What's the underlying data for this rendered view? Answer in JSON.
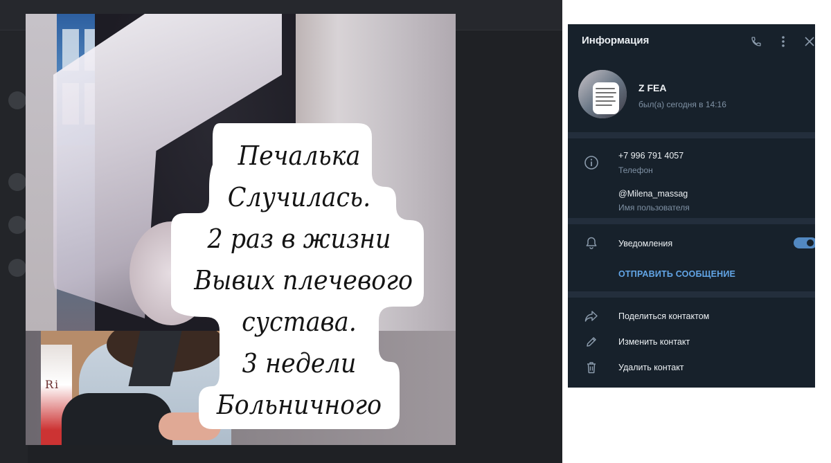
{
  "info_panel": {
    "title": "Информация",
    "header_icons": [
      "phone-icon",
      "more-vertical-icon",
      "close-icon"
    ],
    "contact": {
      "name": "Z FEA",
      "last_seen": "был(а) сегодня в 14:16"
    },
    "phone": {
      "value": "+7 996 791 4057",
      "label": "Телефон"
    },
    "username": {
      "value": "@Milena_massag",
      "label": "Имя пользователя"
    },
    "notifications": {
      "label": "Уведомления",
      "enabled": true
    },
    "send_message_label": "ОТПРАВИТЬ СООБЩЕНИЕ",
    "actions": [
      {
        "icon": "share-icon",
        "label": "Поделиться контактом"
      },
      {
        "icon": "pencil-icon",
        "label": "Изменить контакт"
      },
      {
        "icon": "trash-icon",
        "label": "Удалить контакт"
      }
    ],
    "colors": {
      "panel_bg": "#17212b",
      "accent": "#5288c1",
      "link": "#62a5e6"
    }
  },
  "photo": {
    "sticker_lines": [
      "Печалька",
      "Случилась.",
      "2 раз в жизни",
      "Вывих плечевого",
      "сустава.",
      "3 недели",
      "Больничного"
    ],
    "inset_text": "Ri"
  }
}
